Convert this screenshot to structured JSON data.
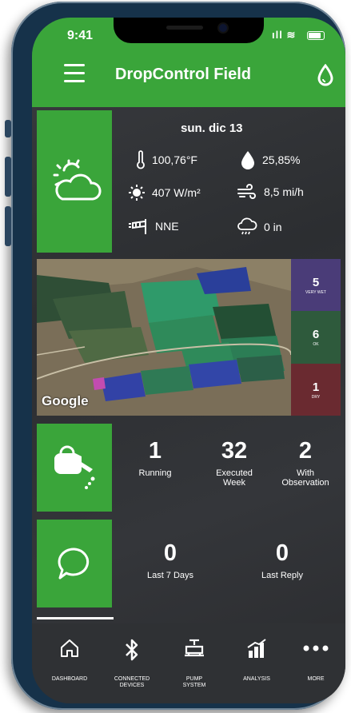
{
  "status_bar": {
    "time": "9:41",
    "signal": "ıll ≋"
  },
  "header": {
    "title": "DropControl Field",
    "menu_icon": "hamburger-menu-icon",
    "logo_icon": "water-drop-icon"
  },
  "weather": {
    "icon": "partly-sunny-icon",
    "date": "sun. dic 13",
    "temperature": "100,76°F",
    "humidity": "25,85%",
    "radiation": "407 W/m²",
    "wind_speed": "8,5 mi/h",
    "wind_direction": "NNE",
    "rain": "0 in"
  },
  "map": {
    "attribution": "Google",
    "legend": [
      {
        "count": "5",
        "label": "VERY WET",
        "color": "#4a3c78"
      },
      {
        "count": "6",
        "label": "OK",
        "color": "#2e5a3c"
      },
      {
        "count": "1",
        "label": "DRY",
        "color": "#6a2a30"
      }
    ]
  },
  "irrigation": {
    "icon": "watering-can-icon",
    "running": {
      "value": "1",
      "label": "Running"
    },
    "executed": {
      "value": "32",
      "label1": "Executed",
      "label2": "Week"
    },
    "observation": {
      "value": "2",
      "label1": "With",
      "label2": "Observation"
    }
  },
  "messages": {
    "icon": "chat-bubble-icon",
    "last7": {
      "value": "0",
      "label": "Last 7 Days"
    },
    "reply": {
      "value": "0",
      "label": "Last Reply"
    }
  },
  "nav": {
    "dashboard": {
      "label": "DASHBOARD",
      "icon": "home-icon"
    },
    "devices": {
      "label1": "CONNECTED",
      "label2": "DEVICES",
      "icon": "bluetooth-icon"
    },
    "pump": {
      "label1": "PUMP",
      "label2": "SYSTEM",
      "icon": "pump-icon"
    },
    "analysis": {
      "label": "ANALYSIS",
      "icon": "chart-bars-icon"
    },
    "more": {
      "label": "MORE",
      "icon": "more-dots-icon"
    }
  },
  "colors": {
    "brand_green": "#3aa53a",
    "field_blue": "#3246a8",
    "field_green": "#2d8a52"
  }
}
